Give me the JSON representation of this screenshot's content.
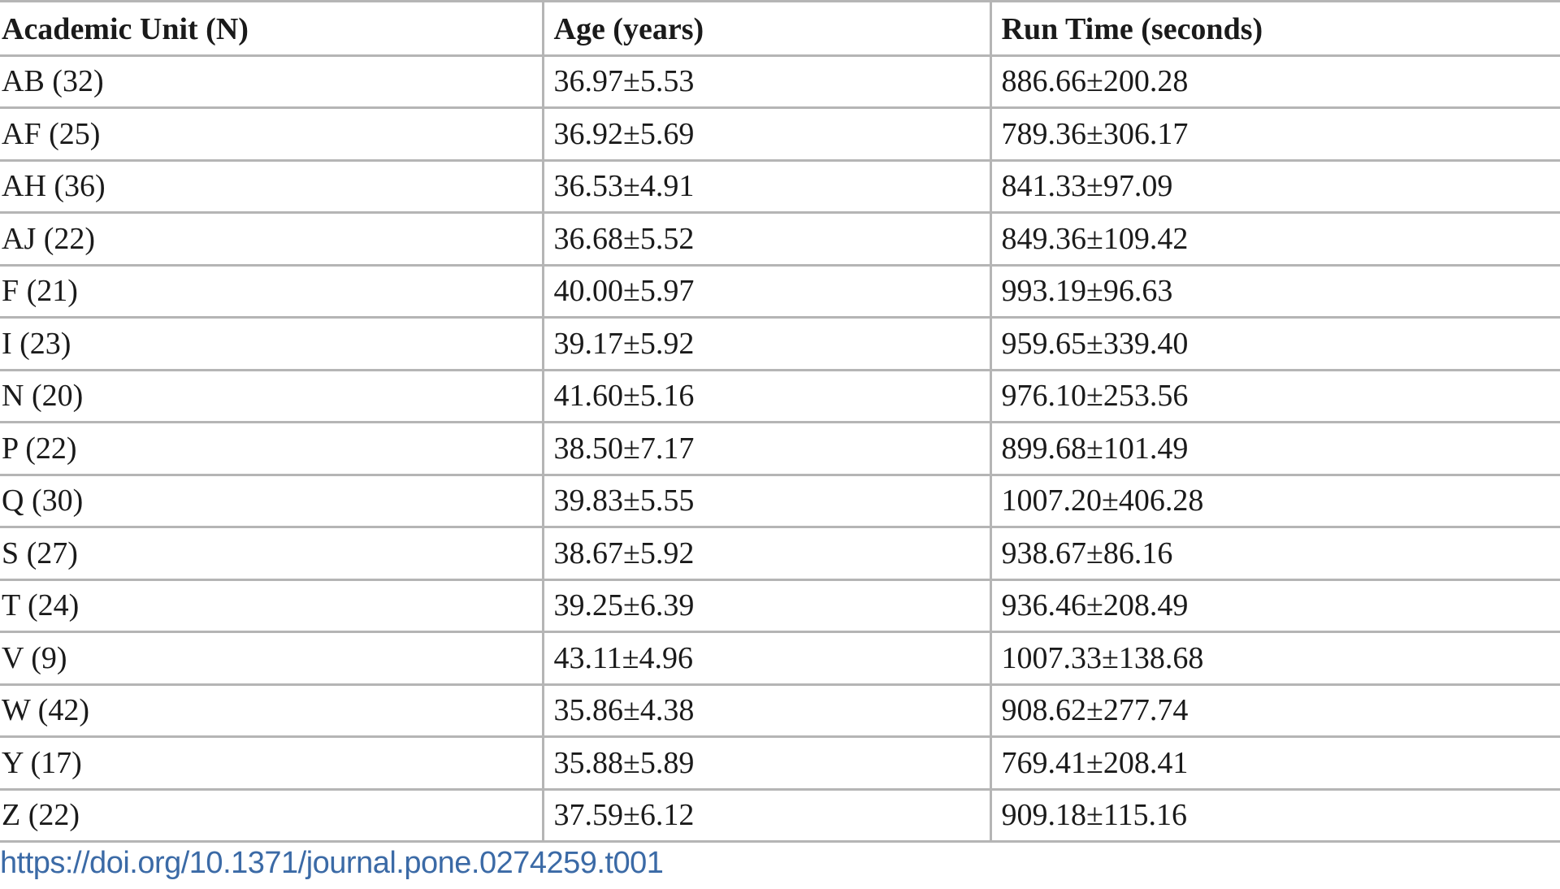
{
  "table": {
    "headers": [
      "Academic Unit (N)",
      "Age (years)",
      "Run Time (seconds)"
    ],
    "rows": [
      [
        "AB (32)",
        "36.97±5.53",
        "886.66±200.28"
      ],
      [
        "AF (25)",
        "36.92±5.69",
        "789.36±306.17"
      ],
      [
        "AH (36)",
        "36.53±4.91",
        "841.33±97.09"
      ],
      [
        "AJ (22)",
        "36.68±5.52",
        "849.36±109.42"
      ],
      [
        "F (21)",
        "40.00±5.97",
        "993.19±96.63"
      ],
      [
        "I (23)",
        "39.17±5.92",
        "959.65±339.40"
      ],
      [
        "N (20)",
        "41.60±5.16",
        "976.10±253.56"
      ],
      [
        "P (22)",
        "38.50±7.17",
        "899.68±101.49"
      ],
      [
        "Q (30)",
        "39.83±5.55",
        "1007.20±406.28"
      ],
      [
        "S (27)",
        "38.67±5.92",
        "938.67±86.16"
      ],
      [
        "T (24)",
        "39.25±6.39",
        "936.46±208.49"
      ],
      [
        "V (9)",
        "43.11±4.96",
        "1007.33±138.68"
      ],
      [
        "W (42)",
        "35.86±4.38",
        "908.62±277.74"
      ],
      [
        "Y (17)",
        "35.88±5.89",
        "769.41±208.41"
      ],
      [
        "Z (22)",
        "37.59±6.12",
        "909.18±115.16"
      ]
    ]
  },
  "footer": {
    "doi": "https://doi.org/10.1371/journal.pone.0274259.t001"
  },
  "colors": {
    "text": "#1a1a1a",
    "rule": "#b5b5b5",
    "link": "#3b6aa6"
  }
}
